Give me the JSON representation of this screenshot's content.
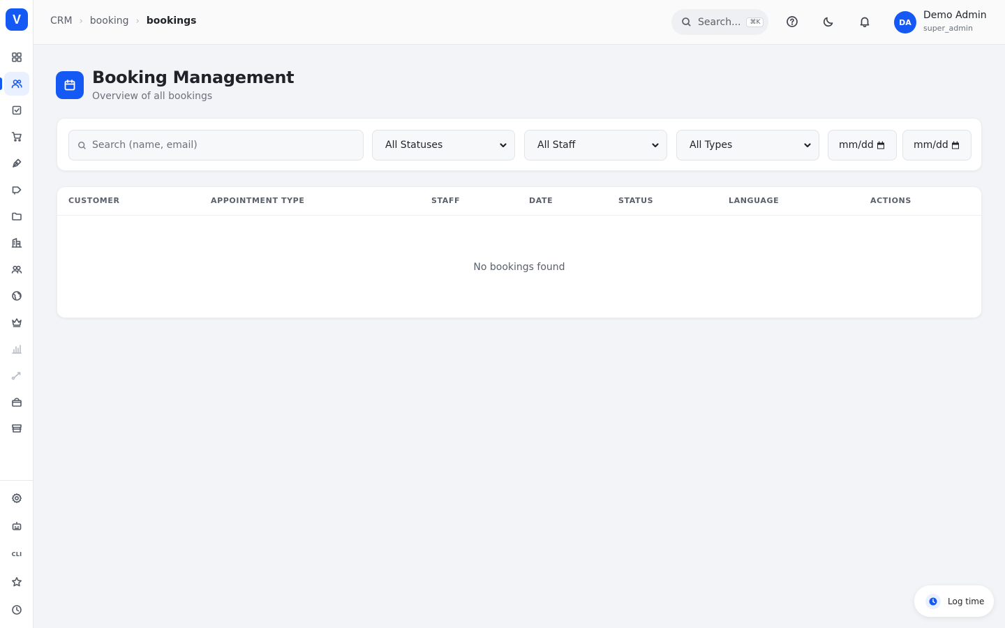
{
  "app": {
    "logo_letter": "V"
  },
  "breadcrumb": {
    "items": [
      "CRM",
      "booking",
      "bookings"
    ]
  },
  "header": {
    "search_label": "Search...",
    "search_shortcut": "⌘K",
    "user": {
      "initials": "DA",
      "name": "Demo Admin",
      "role": "super_admin"
    }
  },
  "sidebar": {
    "items": [
      {
        "icon": "dashboard-grid-icon",
        "active": false
      },
      {
        "icon": "users-icon",
        "active": true
      },
      {
        "icon": "checkbox-icon",
        "active": false
      },
      {
        "icon": "cart-icon",
        "active": false
      },
      {
        "icon": "pen-tool-icon",
        "active": false
      },
      {
        "icon": "megaphone-icon",
        "active": false
      },
      {
        "icon": "folder-icon",
        "active": false
      },
      {
        "icon": "buildings-icon",
        "active": false
      },
      {
        "icon": "team-icon",
        "active": false
      },
      {
        "icon": "globe-icon",
        "active": false
      },
      {
        "icon": "crown-icon",
        "active": false
      },
      {
        "icon": "bar-chart-icon",
        "active": false
      },
      {
        "icon": "route-icon",
        "active": false
      },
      {
        "icon": "gift-icon",
        "active": false
      },
      {
        "icon": "store-icon",
        "active": false
      }
    ],
    "bottom": [
      {
        "icon": "settings-icon"
      },
      {
        "icon": "robot-icon"
      },
      {
        "icon": "cli-icon",
        "label": "CLI"
      },
      {
        "icon": "star-icon"
      },
      {
        "icon": "clock-icon"
      }
    ]
  },
  "page": {
    "title": "Booking Management",
    "subtitle": "Overview of all bookings"
  },
  "filters": {
    "search_placeholder": "Search (name, email)",
    "status_value": "All Statuses",
    "staff_value": "All Staff",
    "type_value": "All Types",
    "date_from": "mm/dd",
    "date_to": "mm/dd"
  },
  "table": {
    "columns": [
      "CUSTOMER",
      "APPOINTMENT TYPE",
      "STAFF",
      "DATE",
      "STATUS",
      "LANGUAGE",
      "ACTIONS"
    ],
    "empty_text": "No bookings found"
  },
  "log_time": {
    "label": "Log time"
  },
  "colors": {
    "accent": "#1559f5"
  }
}
